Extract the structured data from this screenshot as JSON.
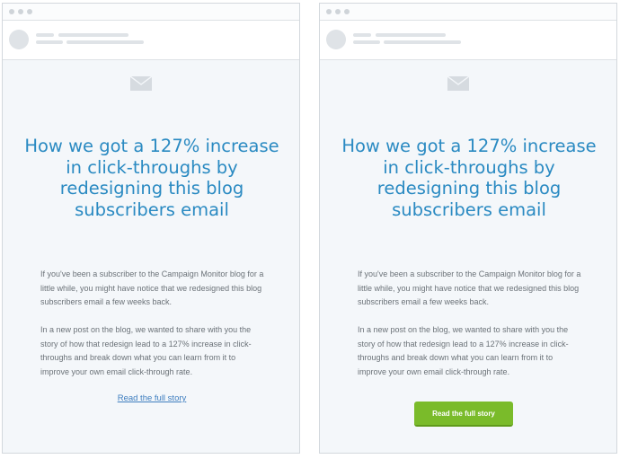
{
  "colors": {
    "headline": "#2a8ac2",
    "body_text": "#6b7278",
    "link": "#3d7dbf",
    "button_bg": "#7abb2a",
    "window_bg": "#f4f7fa"
  },
  "icons": {
    "envelope": "envelope-icon",
    "window_controls": "window-dot-icon",
    "avatar": "avatar-placeholder"
  },
  "variants": {
    "left": {
      "headline": "How we got a 127% increase in click-throughs by redesigning this blog subscribers email",
      "paragraph1": "If you've been a subscriber to the Campaign Monitor blog for a little while, you might have notice that we redesigned this blog subscribers email a few weeks back.",
      "paragraph2": "In a new post on the blog, we wanted to share with you the story of how that redesign lead to a 127% increase in click-throughs and break down what you can learn from it to improve your own email click-through rate.",
      "cta_label": "Read the full story",
      "cta_style": "text-link"
    },
    "right": {
      "headline": "How we got a 127% increase in click-throughs by redesigning this blog subscribers email",
      "paragraph1": "If you've been a subscriber to the Campaign Monitor blog for a little while, you might have notice that we redesigned this blog subscribers email a few weeks back.",
      "paragraph2": "In a new post on the blog, we wanted to share with you the story of how that redesign lead to a 127% increase in click-throughs and break down what you can learn from it to improve your own email click-through rate.",
      "cta_label": "Read the full story",
      "cta_style": "button"
    }
  }
}
